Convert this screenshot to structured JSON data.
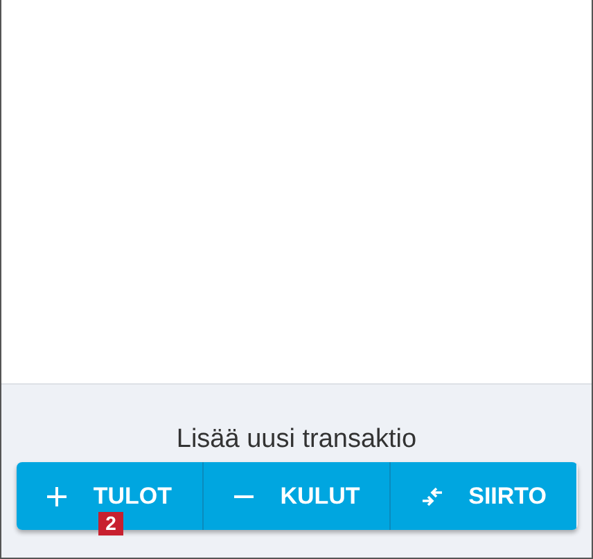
{
  "panel": {
    "title": "Lisää uusi transaktio"
  },
  "buttons": [
    {
      "kind": "plus",
      "label": "TULOT"
    },
    {
      "kind": "minus",
      "label": "KULUT"
    },
    {
      "kind": "transfer",
      "label": "SIIRTO"
    }
  ],
  "callout": {
    "label": "2"
  }
}
